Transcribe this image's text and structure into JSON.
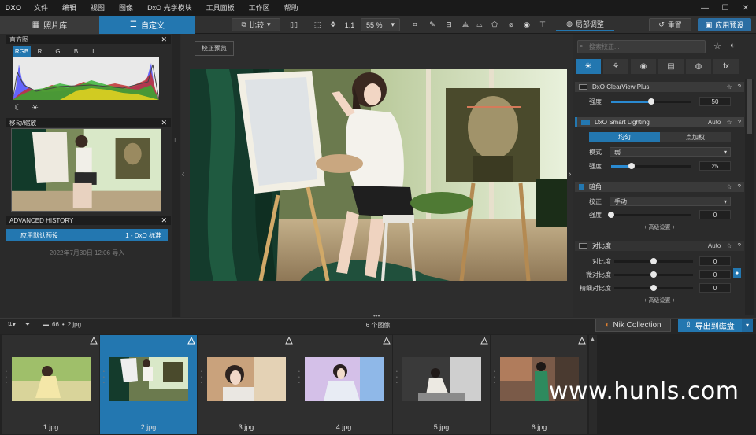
{
  "app": {
    "logo": "DXO"
  },
  "menu": [
    "文件",
    "编辑",
    "视图",
    "图像",
    "DxO 光学模块",
    "工具面板",
    "工作区",
    "帮助"
  ],
  "tabs": {
    "library": "照片库",
    "customize": "自定义"
  },
  "toolbar": {
    "compare": "比较",
    "fit": "1:1",
    "zoom": "55 %",
    "local_adjust": "局部调整",
    "reset": "重置",
    "apply_preset": "应用预设"
  },
  "left": {
    "histogram_title": "直方图",
    "hist_tabs": [
      "RGB",
      "R",
      "G",
      "B",
      "L"
    ],
    "navigator_title": "移动/缩放",
    "history_title": "ADVANCED HISTORY",
    "history_item": "应用默认预设",
    "history_item_value": "1 - DxO 标准",
    "history_date": "2022年7月30日 12:06 导入"
  },
  "center": {
    "preview_button": "校正预览"
  },
  "right": {
    "search_placeholder": "搜索校正...",
    "categories": [
      "☀",
      "⚘",
      "◉",
      "▤",
      "◍",
      "fx"
    ],
    "clearview": {
      "title": "DxO ClearView Plus",
      "intensity_label": "强度",
      "intensity": "50",
      "intensity_frac": 0.5
    },
    "smart_lighting": {
      "title": "DxO Smart Lighting",
      "mode": "Auto",
      "tab_uniform": "均匀",
      "tab_spot": "点加权",
      "mode_label": "模式",
      "mode_value": "弱",
      "intensity_label": "强度",
      "intensity": "25",
      "intensity_frac": 0.25
    },
    "vignetting": {
      "title": "暗角",
      "correction_label": "校正",
      "correction_value": "手动",
      "intensity_label": "强度",
      "intensity": "0",
      "intensity_frac": 0,
      "advanced": "+ 高级设置 +"
    },
    "contrast": {
      "title": "对比度",
      "mode": "Auto",
      "rows": [
        {
          "label": "对比度",
          "value": "0",
          "frac": 0.5
        },
        {
          "label": "微对比度",
          "value": "0",
          "frac": 0.5
        },
        {
          "label": "精细对比度",
          "value": "0",
          "frac": 0.5
        }
      ],
      "advanced": "+ 高级设置 +"
    }
  },
  "filmbar": {
    "folder_count": "66",
    "current_file": "2.jpg",
    "image_count": "6 个图像",
    "nik": "Nik Collection",
    "export": "导出到磁盘"
  },
  "files": [
    "1.jpg",
    "2.jpg",
    "3.jpg",
    "4.jpg",
    "5.jpg",
    "6.jpg"
  ],
  "selected_file_index": 1,
  "watermark": "www.hunls.com",
  "colors": {
    "accent": "#2377b0",
    "background": "#2b2b2b"
  }
}
